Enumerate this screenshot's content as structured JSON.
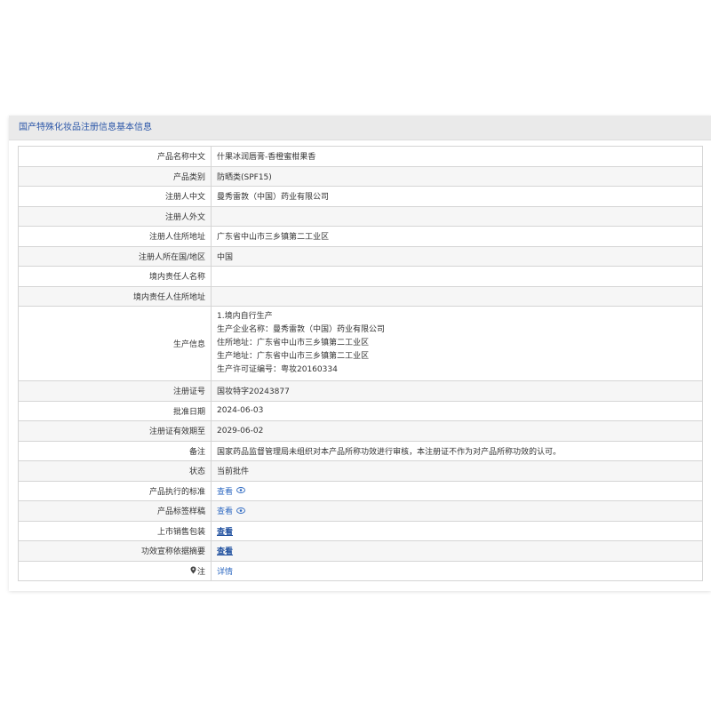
{
  "header": {
    "title": "国产特殊化妆品注册信息基本信息"
  },
  "rows": {
    "product_name_cn": {
      "label": "产品名称中文",
      "value": "什果冰润唇膏-香橙蜜柑果香"
    },
    "product_category": {
      "label": "产品类别",
      "value": "防晒类(SPF15)"
    },
    "registrant_cn": {
      "label": "注册人中文",
      "value": "曼秀雷敦（中国）药业有限公司"
    },
    "registrant_foreign": {
      "label": "注册人外文",
      "value": ""
    },
    "registrant_address": {
      "label": "注册人住所地址",
      "value": "广东省中山市三乡镇第二工业区"
    },
    "registrant_country": {
      "label": "注册人所在国/地区",
      "value": "中国"
    },
    "domestic_responsible_name": {
      "label": "境内责任人名称",
      "value": ""
    },
    "domestic_responsible_address": {
      "label": "境内责任人住所地址",
      "value": ""
    },
    "production_info": {
      "label": "生产信息",
      "lines": [
        "1.境内自行生产",
        "生产企业名称：曼秀雷敦（中国）药业有限公司",
        "住所地址：广东省中山市三乡镇第二工业区",
        "生产地址：广东省中山市三乡镇第二工业区",
        "生产许可证编号：粤妆20160334"
      ]
    },
    "registration_no": {
      "label": "注册证号",
      "value": "国妆特字20243877"
    },
    "approval_date": {
      "label": "批准日期",
      "value": "2024-06-03"
    },
    "valid_until": {
      "label": "注册证有效期至",
      "value": "2029-06-02"
    },
    "remarks": {
      "label": "备注",
      "value": "国家药品监督管理局未组织对本产品所称功效进行审核，本注册证不作为对产品所称功效的认可。"
    },
    "status": {
      "label": "状态",
      "value": "当前批件"
    },
    "product_standard": {
      "label": "产品执行的标准",
      "link": "查看"
    },
    "product_label": {
      "label": "产品标签样稿",
      "link": "查看"
    },
    "sales_packaging": {
      "label": "上市销售包装",
      "link": "查看"
    },
    "efficacy_summary": {
      "label": "功效宣称依据摘要",
      "link": "查看"
    },
    "note": {
      "label": "注",
      "link": "详情"
    }
  },
  "icons": {
    "eye": "eye-icon",
    "pin": "pin-icon"
  },
  "colors": {
    "link": "#2f6ac2",
    "header_text": "#2b56a8",
    "border": "#d5d5d5"
  }
}
